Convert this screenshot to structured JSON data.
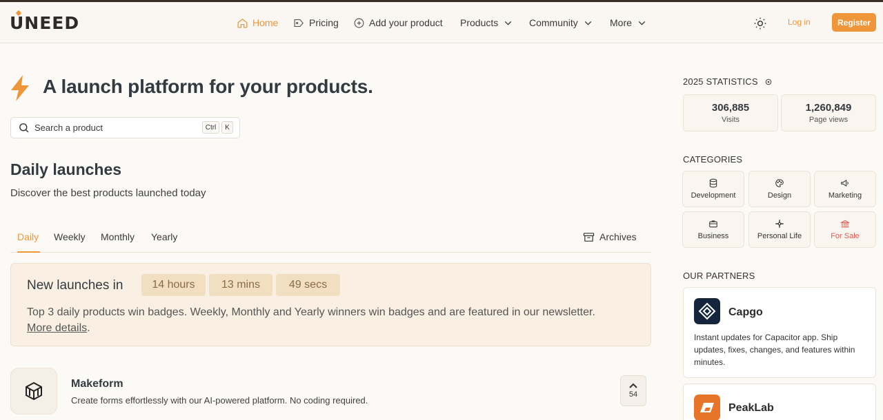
{
  "brand": {
    "logo_text": "UNEED",
    "accent": "#f0963a"
  },
  "nav": {
    "home": "Home",
    "pricing": "Pricing",
    "add_product": "Add your product",
    "products": "Products",
    "community": "Community",
    "more": "More",
    "login": "Log in",
    "register": "Register"
  },
  "hero": {
    "title": "A launch platform for your products.",
    "search_placeholder": "Search a product",
    "shortcut_ctrl": "Ctrl",
    "shortcut_k": "K"
  },
  "launches": {
    "title": "Daily launches",
    "subtitle": "Discover the best products launched today",
    "tabs": [
      "Daily",
      "Weekly",
      "Monthly",
      "Yearly"
    ],
    "active_tab": "Daily",
    "archives": "Archives"
  },
  "notice": {
    "title": "New launches in",
    "hours": "14 hours",
    "mins": "13 mins",
    "secs": "49 secs",
    "text": "Top 3 daily products win badges. Weekly, Monthly and Yearly winners win badges and are featured in our newsletter.",
    "link": "More details",
    "link_suffix": "."
  },
  "product": {
    "name": "Makeform",
    "description": "Create forms effortlessly with our AI-powered platform. No coding required.",
    "votes": "54"
  },
  "sidebar": {
    "stats_title": "2025 STATISTICS",
    "visits_value": "306,885",
    "visits_label": "Visits",
    "views_value": "1,260,849",
    "views_label": "Page views",
    "categories_title": "CATEGORIES",
    "categories": [
      "Development",
      "Design",
      "Marketing",
      "Business",
      "Personal Life",
      "For Sale"
    ],
    "partners_title": "OUR PARTNERS",
    "partners": [
      {
        "name": "Capgo",
        "description": "Instant updates for Capacitor app. Ship updates, fixes, changes, and features within minutes."
      },
      {
        "name": "PeakLab"
      }
    ]
  }
}
